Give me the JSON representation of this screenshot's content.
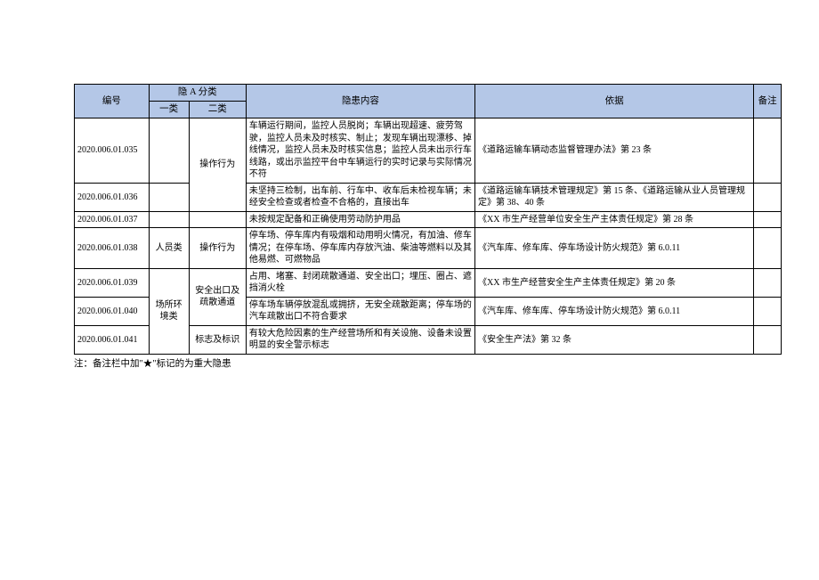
{
  "header": {
    "id": "编号",
    "hidden_cat": "隐 A 分类",
    "cat1": "一类",
    "cat2": "二类",
    "content": "隐患内容",
    "basis": "依据",
    "remark": "备注"
  },
  "rows": [
    {
      "id": "2020.006.01.035",
      "cat1": "",
      "cat2_group": "操作行为",
      "cat2": "",
      "content": "车辆运行期间，监控人员脱岗；车辆出现超速、疲劳驾驶，监控人员未及时核实、制止；发现车辆出现漂移、掉线情况，监控人员未及时核实信息；监控人员未出示行车线路，或出示监控平台中车辆运行的实时记录与实际情况不符",
      "basis": "《道路运输车辆动态监督管理办法》第 23 条",
      "remark": ""
    },
    {
      "id": "2020.006.01.036",
      "cat1": "",
      "cat2": "",
      "content": "未坚持三检制，出车前、行车中、收车后未检视车辆；未经安全检查或者检查不合格的，直接出车",
      "basis": "《道路运输车辆技术管理规定》第 15 条、《道路运输从业人员管理规定》第 38、40 条",
      "remark": ""
    },
    {
      "id": "2020.006.01.037",
      "cat1": "",
      "cat2": "",
      "content": "未按规定配备和正确使用劳动防护用品",
      "basis": "《XX 市生产经营单位安全生产主体责任规定》第 28 条",
      "remark": ""
    },
    {
      "id": "2020.006.01.038",
      "cat1": "人员类",
      "cat2": "操作行为",
      "content": "停车场、停车库内有吸烟和动用明火情况，有加油、修车情况；在停车场、停车库内存放汽油、柴油等燃料以及其他易燃、可燃物品",
      "basis": "《汽车库、修车库、停车场设计防火规范》第 6.0.11",
      "remark": ""
    },
    {
      "id": "2020.006.01.039",
      "cat1_group": "场所环境类",
      "cat2_group": "安全出口及疏散通道",
      "content": "占用、堵塞、封闭疏散通道、安全出口；埋压、圈占、遮挡消火栓",
      "basis": "《XX 市生产经营安全生产主体责任规定》第 20 条",
      "remark": ""
    },
    {
      "id": "2020.006.01.040",
      "content": "停车场车辆停放混乱或拥挤，无安全疏散距离；停车场的汽车疏散出口不符合要求",
      "basis": "《汽车库、修车库、停车场设计防火规范》第 6.0.11",
      "remark": ""
    },
    {
      "id": "2020.006.01.041",
      "cat2": "标志及标识",
      "content": "有较大危险因素的生产经营场所和有关设施、设备未设置明显的安全警示标志",
      "basis": "《安全生产法》第 32 条",
      "remark": ""
    }
  ],
  "footnote": "注：备注栏中加\"★\"标记的为重大隐患"
}
